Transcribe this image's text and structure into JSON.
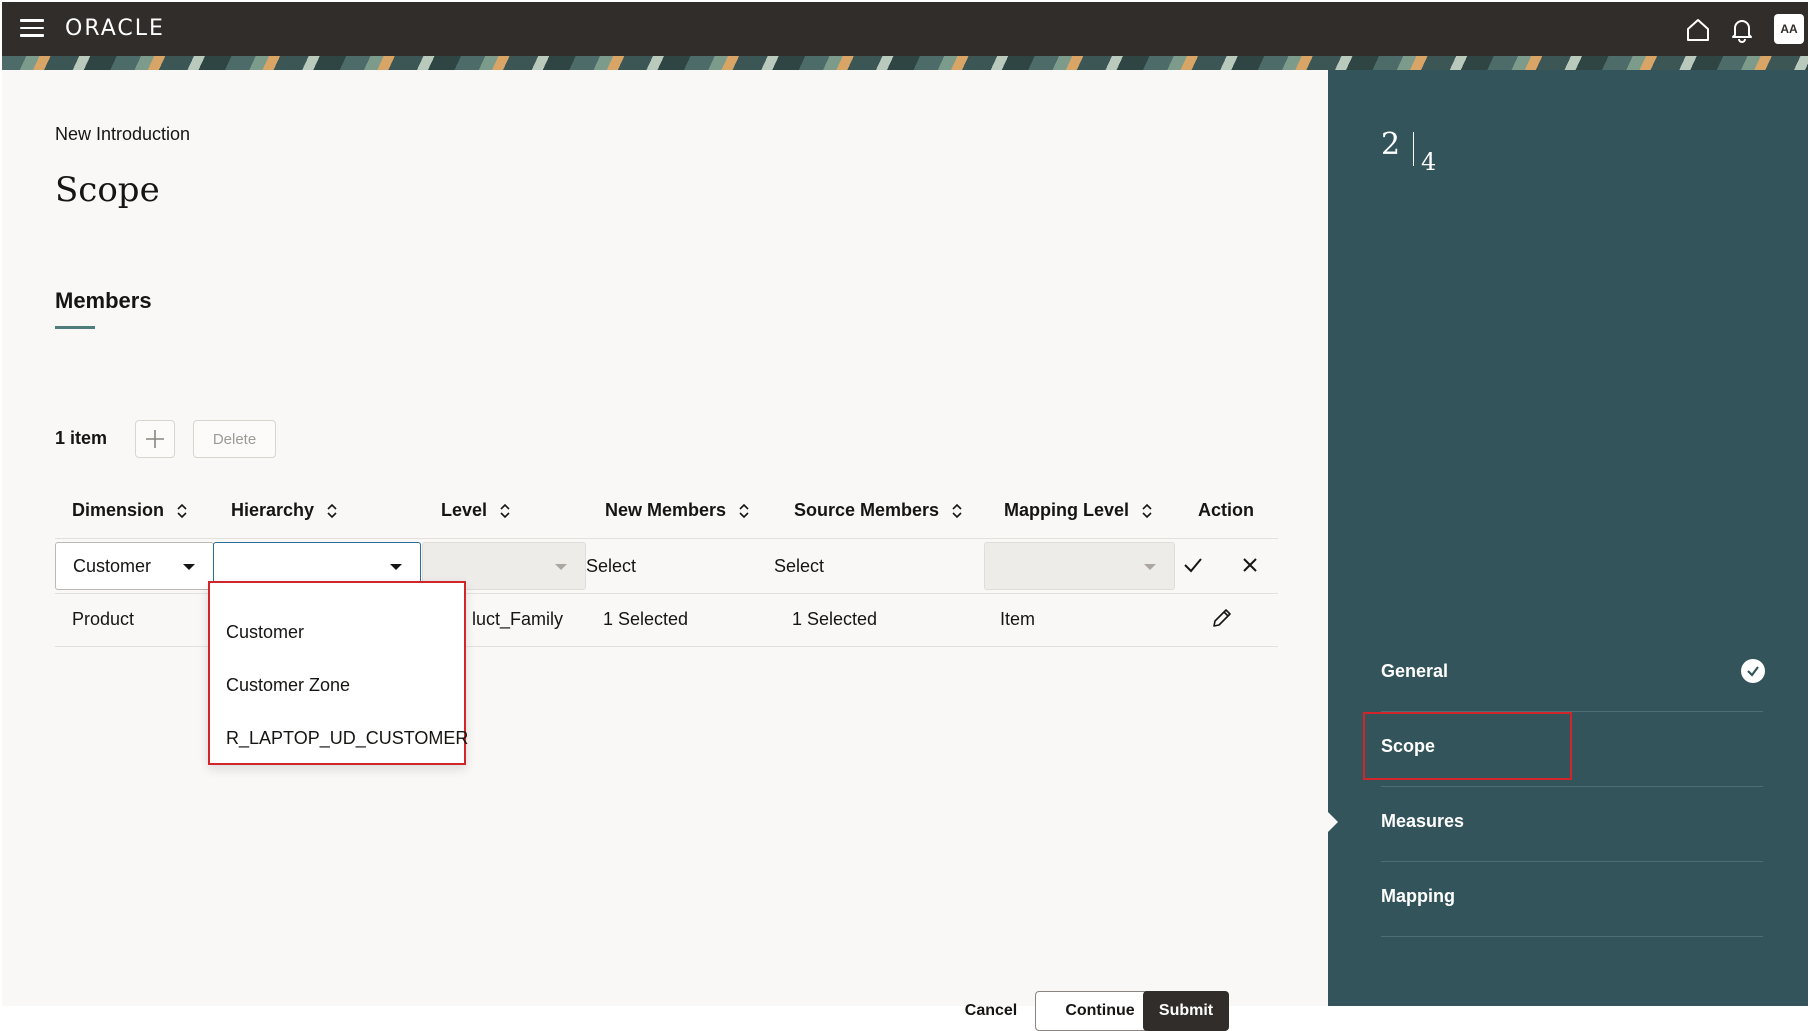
{
  "header": {
    "logo": "ORACLE",
    "avatar": "AA"
  },
  "page": {
    "eyebrow": "New Introduction",
    "title": "Scope",
    "section": "Members"
  },
  "toolbar": {
    "count": "1 item",
    "delete_label": "Delete"
  },
  "table": {
    "columns": [
      "Dimension",
      "Hierarchy",
      "Level",
      "New Members",
      "Source Members",
      "Mapping Level",
      "Action"
    ],
    "edit_row": {
      "dimension": "Customer",
      "hierarchy": "",
      "new_members": "Select",
      "source_members": "Select"
    },
    "row": {
      "dimension": "Product",
      "level_partial": "luct_Family",
      "new_members": "1 Selected",
      "source_members": "1 Selected",
      "mapping_level": "Item"
    }
  },
  "dropdown": {
    "options": [
      "Customer",
      "Customer Zone",
      "R_LAPTOP_UD_CUSTOMER"
    ]
  },
  "footer": {
    "cancel": "Cancel",
    "continue": "Continue",
    "submit": "Submit"
  },
  "side": {
    "current_step": "2",
    "total_steps": "4",
    "steps": [
      "General",
      "Scope",
      "Measures",
      "Mapping"
    ]
  }
}
